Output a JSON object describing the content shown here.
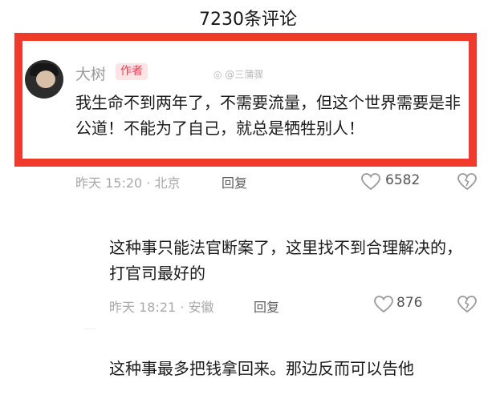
{
  "header": {
    "title": "7230条评论"
  },
  "watermark": "@三蒲骤",
  "comments": [
    {
      "author": "大树",
      "badge": "作者",
      "text": "我生命不到两年了，不需要流量，但这个世界需要是非公道！不能为了自己，就总是牺牲别人！",
      "time": "昨天 15:20 · 北京",
      "reply": "回复",
      "likes": "6582"
    },
    {
      "text": "这种事只能法官断案了，这里找不到合理解决的，打官司最好的",
      "time": "昨天 18:21 · 安徽",
      "reply": "回复",
      "likes": "876"
    },
    {
      "text": "这种事最多把钱拿回来。那边反而可以告他"
    }
  ],
  "colors": {
    "highlight": "#f13a2c",
    "badge_bg": "#fbe4e6",
    "badge_text": "#f23d54"
  }
}
